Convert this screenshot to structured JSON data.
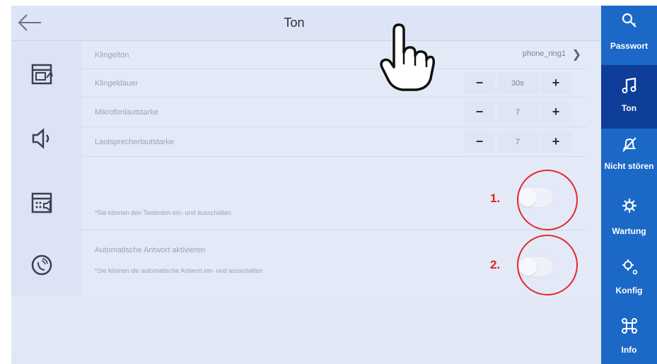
{
  "header": {
    "title": "Ton"
  },
  "left_icons": [
    "ringtone-settings-icon",
    "speaker-volume-icon",
    "keypad-tone-icon",
    "auto-answer-icon"
  ],
  "settings": {
    "ringtone": {
      "label": "Klingelton",
      "value": "phone_ring1"
    },
    "ring_duration": {
      "label": "Klingeldauer",
      "minus": "−",
      "value": "30s",
      "plus": "+"
    },
    "mic_volume": {
      "label": "Mikrofonlautstarke",
      "minus": "−",
      "value": "7",
      "plus": "+"
    },
    "speaker_volume": {
      "label": "Lautsprecherlautstarke",
      "minus": "−",
      "value": "7",
      "plus": "+"
    },
    "key_tone": {
      "note": "*Sie können den Tastenton ein- und ausschalten"
    },
    "auto_answer": {
      "label": "Automatische Antwort aktivieren",
      "note": "*Sie können die automatische Antwort ein- und ausschalten"
    }
  },
  "sidebar": {
    "items": [
      {
        "label": "Passwort",
        "icon": "key-icon"
      },
      {
        "label": "Ton",
        "icon": "music-note-icon"
      },
      {
        "label": "Nicht stören",
        "icon": "bell-off-icon"
      },
      {
        "label": "Wartung",
        "icon": "wrench-gear-icon"
      },
      {
        "label": "Konfig",
        "icon": "gears-icon"
      },
      {
        "label": "Info",
        "icon": "command-icon"
      }
    ]
  },
  "annotations": {
    "marker1": "1.",
    "marker2": "2."
  },
  "colors": {
    "sidebar": "#1b68c7",
    "sidebar_active": "#0f3e9a",
    "annotation_red": "#e02a2a"
  }
}
